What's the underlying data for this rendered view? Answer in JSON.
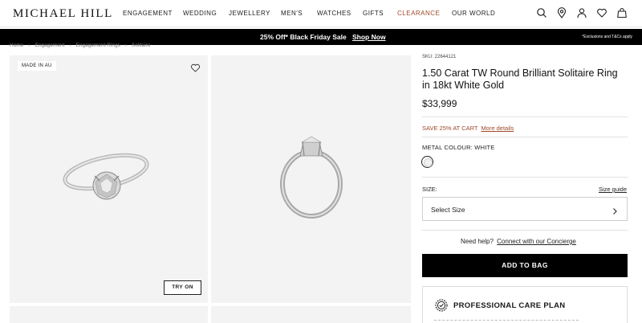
{
  "brand": {
    "logo": "MICHAEL HILL"
  },
  "nav": {
    "items": [
      {
        "label": "ENGAGEMENT"
      },
      {
        "label": "WEDDING"
      },
      {
        "label": "JEWELLERY"
      },
      {
        "label": "MEN'S"
      },
      {
        "label": "WATCHES"
      },
      {
        "label": "GIFTS"
      },
      {
        "label": "CLEARANCE",
        "color": "#a0492b"
      },
      {
        "label": "OUR WORLD"
      }
    ]
  },
  "header_icons": [
    "search-icon",
    "location-pin-icon",
    "account-icon",
    "heart-icon",
    "bag-icon"
  ],
  "promo": {
    "text": "25% Off* Black Friday Sale",
    "link": "Shop Now",
    "note": "*Exclusions and T&Cs apply"
  },
  "breadcrumb": [
    "Home",
    "›",
    "Engagement",
    "›",
    "Engagement Rings",
    "›",
    "Solitaire"
  ],
  "gallery": {
    "badge": "MADE IN AU",
    "try_on": "TRY ON"
  },
  "product": {
    "sku": "SKU: 22644121",
    "title": "1.50 Carat TW Round Brilliant Solitaire Ring in 18kt White Gold",
    "price": "$33,999",
    "save_text": "SAVE 25% AT CART",
    "save_link": "More details",
    "metal_label": "METAL COLOUR: WHITE",
    "size_label": "SIZE:",
    "size_guide": "Size guide",
    "size_value": "Select Size",
    "help_text": "Need help?",
    "help_link": "Connect with our Concierge",
    "add_to_bag": "ADD TO BAG",
    "care_plan": "PROFESSIONAL CARE PLAN"
  },
  "colors": {
    "accent": "#a0492b",
    "promo_bg": "#000000",
    "tile_bg": "#f3f3f3"
  }
}
